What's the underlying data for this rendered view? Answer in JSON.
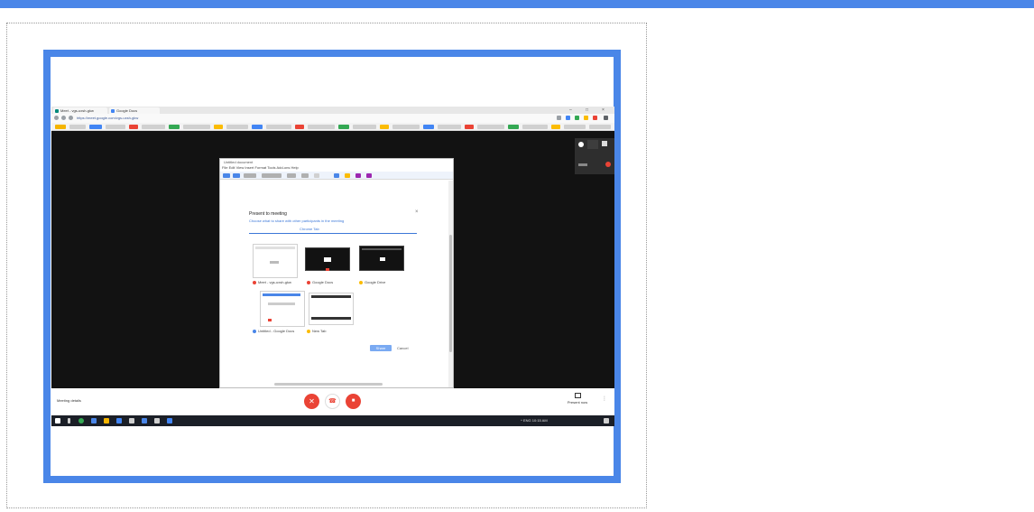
{
  "colors": {
    "accent": "#4a86e8",
    "meeting_bg": "#121212",
    "end_call": "#ea4335",
    "taskbar": "#1b1f27"
  },
  "browser": {
    "tabs": [
      {
        "label": "Meet - vgs-uxsh-gkw",
        "icon": "meet-icon"
      },
      {
        "label": "Google Docs",
        "icon": "docs-icon"
      }
    ],
    "address": "https://meet.google.com/vgs-uxsh-gkw",
    "window_controls": [
      "–",
      "□",
      "×"
    ]
  },
  "doc_window": {
    "title": "Untitled document",
    "menu": [
      "File",
      "Edit",
      "View",
      "Insert",
      "Format",
      "Tools",
      "Add-ons",
      "Help"
    ],
    "dialog": {
      "title": "Present to meeting",
      "subtitle": "Choose what to share with other participants in the meeting",
      "tab": "Chrome Tab",
      "items": [
        "Meet - vgs-uxsh-gkw",
        "Google Docs",
        "Google Drive",
        "Untitled - Google Docs",
        "New Tab"
      ],
      "share_label": "Share",
      "cancel_label": "Cancel",
      "close_icon": "close-icon"
    }
  },
  "meet": {
    "meeting_details": "Meeting details",
    "present_now": "Present now",
    "controls": [
      {
        "name": "mic-off-button",
        "icon": "mic-off-icon",
        "glyph": "✕"
      },
      {
        "name": "leave-call-button",
        "icon": "phone-hangup-icon",
        "glyph": "☎"
      },
      {
        "name": "camera-off-button",
        "icon": "camera-off-icon",
        "glyph": "■"
      }
    ],
    "more": "⋮"
  },
  "taskbar": {
    "tray_text": "^ ENG 10:15 AM"
  }
}
